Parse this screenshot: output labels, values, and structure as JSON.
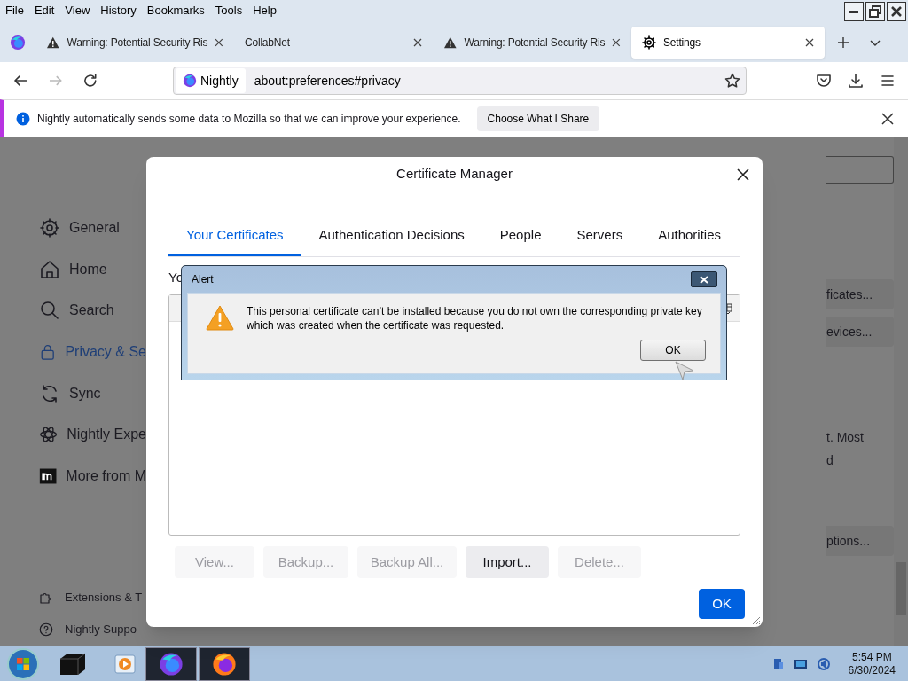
{
  "menu_bar": [
    "File",
    "Edit",
    "View",
    "History",
    "Bookmarks",
    "Tools",
    "Help"
  ],
  "tabs": [
    {
      "kind": "warning",
      "label": "Warning: Potential Security Ris",
      "selected": false
    },
    {
      "kind": "plain",
      "label": "CollabNet",
      "selected": false
    },
    {
      "kind": "warning",
      "label": "Warning: Potential Security Ris",
      "selected": false
    },
    {
      "kind": "settings",
      "label": "Settings",
      "selected": true
    }
  ],
  "nav_bar": {
    "identity": "Nightly",
    "url": "about:preferences#privacy"
  },
  "notification": {
    "message": "Nightly automatically sends some data to Mozilla so that we can improve your experience.",
    "button": "Choose What I Share"
  },
  "settings_sidebar": [
    {
      "kind": "gear",
      "label": "General",
      "selected": false
    },
    {
      "kind": "home",
      "label": "Home",
      "selected": false
    },
    {
      "kind": "search",
      "label": "Search",
      "selected": false
    },
    {
      "kind": "lock",
      "label": "Privacy & Se",
      "selected": true
    },
    {
      "kind": "sync",
      "label": "Sync",
      "selected": false
    },
    {
      "kind": "atom",
      "label": "Nightly Expe",
      "selected": false
    },
    {
      "kind": "mozilla",
      "label": "More from M",
      "selected": false
    }
  ],
  "settings_footer": [
    {
      "kind": "puzzle",
      "label": "Extensions & T"
    },
    {
      "kind": "help",
      "label": "Nightly Suppo"
    }
  ],
  "settings_right": [
    {
      "kind": "button",
      "text": "ficates..."
    },
    {
      "kind": "button",
      "text": "evices..."
    },
    {
      "kind": "text",
      "text": "t. Most"
    },
    {
      "kind": "text",
      "text": "d"
    },
    {
      "kind": "button",
      "text": "ptions..."
    }
  ],
  "certificate_manager": {
    "title": "Certificate Manager",
    "tabs": [
      {
        "label": "Your Certificates",
        "selected": true
      },
      {
        "label": "Authentication Decisions",
        "selected": false
      },
      {
        "label": "People",
        "selected": false
      },
      {
        "label": "Servers",
        "selected": false
      },
      {
        "label": "Authorities",
        "selected": false
      }
    ],
    "intro": "Yo",
    "buttons": [
      {
        "label": "View...",
        "disabled": true
      },
      {
        "label": "Backup...",
        "disabled": true
      },
      {
        "label": "Backup All...",
        "disabled": true
      },
      {
        "label": "Import...",
        "disabled": false
      },
      {
        "label": "Delete...",
        "disabled": true
      }
    ],
    "ok": "OK"
  },
  "alert": {
    "title": "Alert",
    "message": "This personal certificate can’t be installed because you do not own the corresponding private key which was created when the certificate was requested.",
    "ok": "OK"
  },
  "taskbar": {
    "time": "5:54 PM",
    "date": "6/30/2024"
  }
}
